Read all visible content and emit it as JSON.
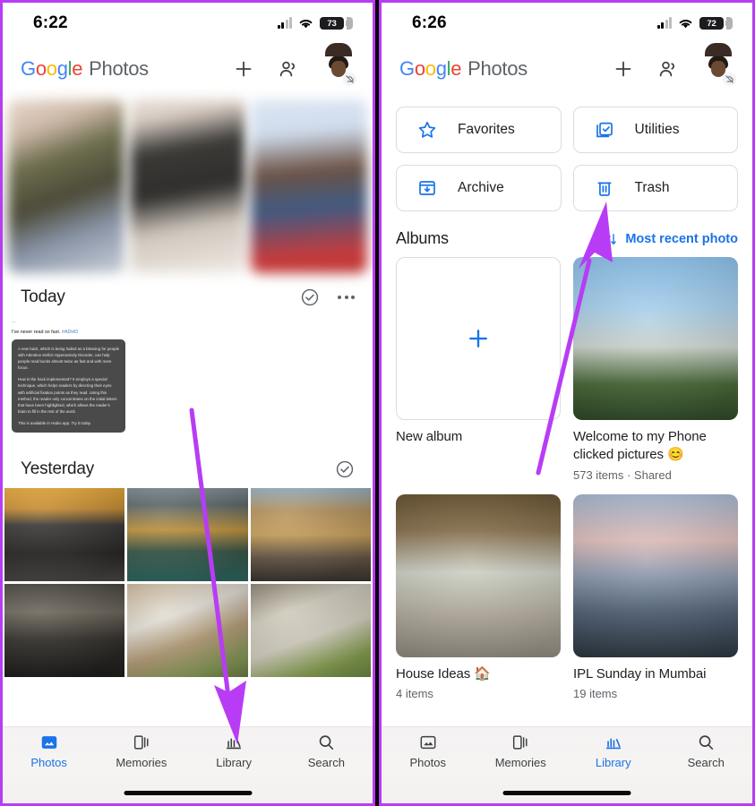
{
  "annotation": {
    "arrow_color": "#b83cf5",
    "frame_color": "#b83cf5"
  },
  "left_phone": {
    "status": {
      "time": "6:22",
      "battery": "73",
      "signal_icon": "cellular-icon",
      "wifi_icon": "wifi-icon"
    },
    "appbar": {
      "logo_google": [
        "G",
        "o",
        "o",
        "g",
        "l",
        "e"
      ],
      "logo_word": "Photos",
      "add_icon": "plus-icon",
      "sharing_icon": "people-icon",
      "avatar_icon": "avatar",
      "avatar_badge_icon": "backup-off-icon"
    },
    "memories": [
      {
        "name": "memory-1"
      },
      {
        "name": "memory-2"
      },
      {
        "name": "memory-3"
      }
    ],
    "sections": [
      {
        "title": "Today",
        "select_icon": "check-circle-icon",
        "more_icon": "more-options-icon",
        "screenshot": {
          "handle": "—",
          "caption": "I've never read so fast.",
          "hashtag": "#ADHD",
          "body": [
            "A new hack, which is being hailed as a blessing for people with Attention Deficit Hyperactivity Disorder, can help people read books almost twice as fast and with more focus.",
            "How is the hack implemented? It employs a special technique, which helps readers by directing their eyes with artificial fixation points as they read. Using this method, the reader only concentrates on the initial letters that have been highlighted, which allows the reader's brain to fill in the rest of the word.",
            "This is available in Habio app. Try it today"
          ]
        }
      },
      {
        "title": "Yesterday",
        "select_icon": "check-circle-icon",
        "photos": [
          {
            "name": "photo-black-sports-car"
          },
          {
            "name": "photo-crowded-market-street"
          },
          {
            "name": "photo-narrow-alley-evening"
          },
          {
            "name": "photo-gym-interior"
          },
          {
            "name": "photo-plate-of-food"
          },
          {
            "name": "photo-bowl-of-curry"
          }
        ]
      }
    ],
    "bottom_nav": {
      "active": "Photos",
      "items": [
        {
          "label": "Photos",
          "icon": "photos-icon"
        },
        {
          "label": "Memories",
          "icon": "memories-icon"
        },
        {
          "label": "Library",
          "icon": "library-icon"
        },
        {
          "label": "Search",
          "icon": "search-icon"
        }
      ]
    }
  },
  "right_phone": {
    "status": {
      "time": "6:26",
      "battery": "72",
      "signal_icon": "cellular-icon",
      "wifi_icon": "wifi-icon"
    },
    "appbar": {
      "logo_google": [
        "G",
        "o",
        "o",
        "g",
        "l",
        "e"
      ],
      "logo_word": "Photos",
      "add_icon": "plus-icon",
      "sharing_icon": "people-icon",
      "avatar_icon": "avatar",
      "avatar_badge_icon": "backup-off-icon"
    },
    "chips": [
      {
        "label": "Favorites",
        "icon": "star-icon"
      },
      {
        "label": "Utilities",
        "icon": "utilities-icon"
      },
      {
        "label": "Archive",
        "icon": "archive-icon"
      },
      {
        "label": "Trash",
        "icon": "trash-icon"
      }
    ],
    "albums_section": {
      "title": "Albums",
      "sort_icon": "sort-icon",
      "sort_label": "Most recent photo"
    },
    "albums": [
      {
        "name": "New album",
        "meta": "",
        "thumb": "new-album-placeholder",
        "add_icon": "plus-icon"
      },
      {
        "name": "Welcome to my Phone clicked pictures 😊",
        "meta": "573 items  ·  Shared",
        "thumb": "photo-apartment-building"
      },
      {
        "name": "House Ideas 🏠",
        "meta": "4 items",
        "thumb": "photo-balcony-lounge"
      },
      {
        "name": "IPL Sunday in Mumbai",
        "meta": "19 items",
        "thumb": "photo-seaside-skyline"
      }
    ],
    "bottom_nav": {
      "active": "Library",
      "items": [
        {
          "label": "Photos",
          "icon": "photos-icon"
        },
        {
          "label": "Memories",
          "icon": "memories-icon"
        },
        {
          "label": "Library",
          "icon": "library-icon"
        },
        {
          "label": "Search",
          "icon": "search-icon"
        }
      ]
    }
  },
  "colors": {
    "accent_blue": "#1a73e8",
    "text_primary": "#202124",
    "text_secondary": "#5f6368"
  }
}
